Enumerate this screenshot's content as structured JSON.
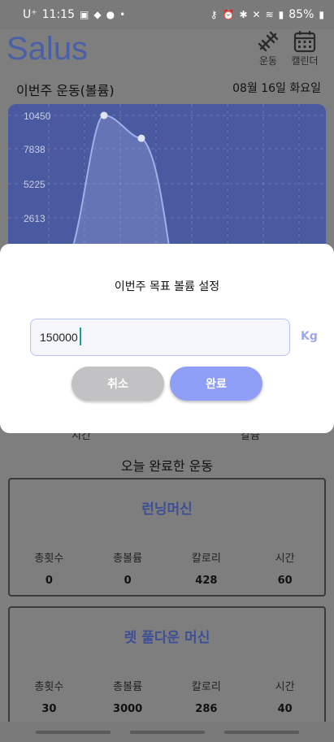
{
  "status": {
    "carrier": "U⁺",
    "time": "11:15",
    "battery": "85%"
  },
  "app": {
    "logo": "Salus",
    "nav_exercise": "운동",
    "nav_calendar": "캘린더"
  },
  "weekly": {
    "title": "이번주 운동(볼륨)",
    "date": "08월 16일 화요일"
  },
  "chart_data": {
    "type": "line",
    "y_ticks": [
      "10450",
      "7838",
      "5225",
      "2613"
    ],
    "points_visible": [
      {
        "y": 10450
      },
      {
        "y": 8700
      }
    ],
    "grid": true,
    "colors": {
      "background": "#4a5aa0",
      "line": "#9fb0e8",
      "point": "#e0e3f0"
    }
  },
  "dialog": {
    "title": "이번주 목표 볼륨 설정",
    "input_value": "150000",
    "unit": "Kg",
    "cancel_label": "취소",
    "done_label": "완료"
  },
  "under_dialog": {
    "left_label": "시간",
    "right_label": "칼슘"
  },
  "today": {
    "title": "오늘 완료한 운동",
    "cards": [
      {
        "name": "런닝머신",
        "stats": [
          {
            "label": "총횟수",
            "value": "0"
          },
          {
            "label": "총볼륨",
            "value": "0"
          },
          {
            "label": "칼로리",
            "value": "428"
          },
          {
            "label": "시간",
            "value": "60"
          }
        ]
      },
      {
        "name": "렛 풀다운 머신",
        "stats": [
          {
            "label": "총횟수",
            "value": "30"
          },
          {
            "label": "총볼륨",
            "value": "3000"
          },
          {
            "label": "칼로리",
            "value": "286"
          },
          {
            "label": "시간",
            "value": "40"
          }
        ]
      }
    ]
  }
}
